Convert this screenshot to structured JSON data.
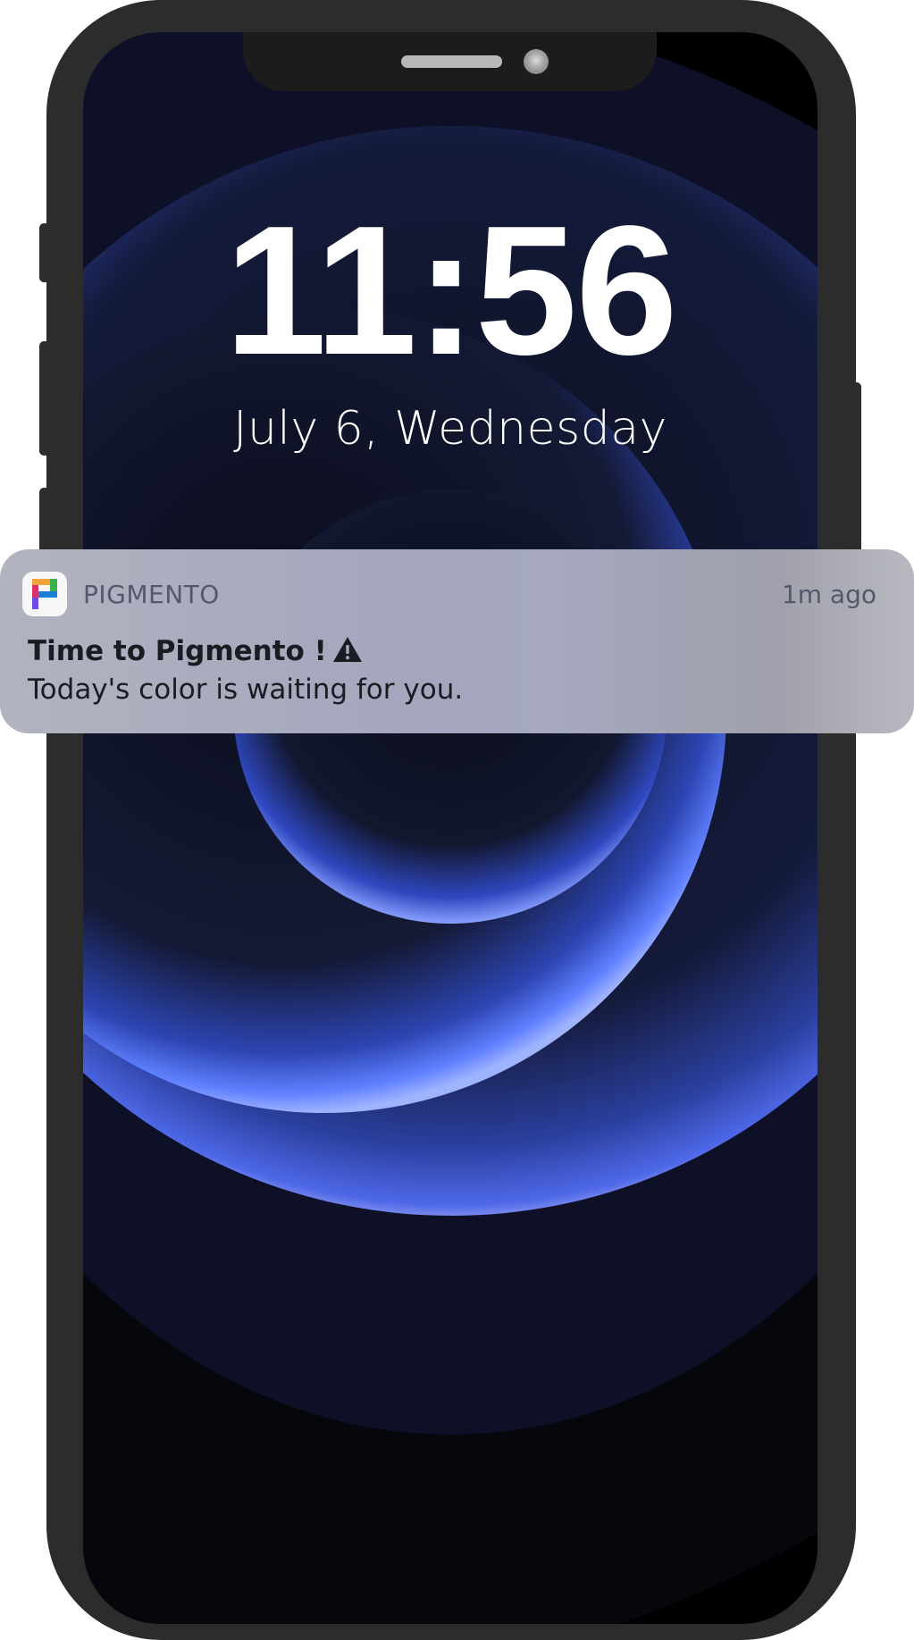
{
  "lockscreen": {
    "time": "11:56",
    "date": "July 6, Wednesday"
  },
  "notification": {
    "app_name": "PIGMENTO",
    "timestamp": "1m ago",
    "title": "Time to Pigmento !",
    "title_icon": "warning-icon",
    "body": "Today's color is waiting for you.",
    "app_icon": "pigmento-logo-icon"
  },
  "colors": {
    "frame": "#2c2c2c",
    "wallpaper_blue": "#3f5cff",
    "notification_bg": "#a5a8c0",
    "text_dark": "#1b1b22"
  }
}
